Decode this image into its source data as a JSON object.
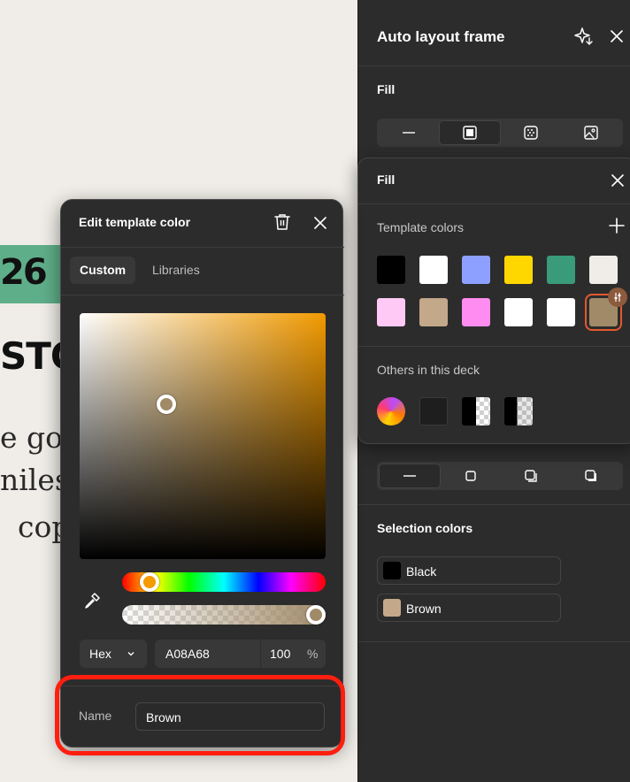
{
  "canvas": {
    "badge_text": "26",
    "heading_fragment": "STO",
    "body_lines": [
      "e  go",
      "nilest",
      "cop"
    ]
  },
  "panel": {
    "title": "Auto layout frame",
    "fill_label": "Fill",
    "selection_colors_label": "Selection colors",
    "selection_colors": [
      {
        "name": "Black",
        "color": "#000000"
      },
      {
        "name": "Brown",
        "color": "#c4a88a"
      }
    ]
  },
  "fill_popover": {
    "title": "Fill",
    "template_colors_label": "Template colors",
    "template_colors": [
      "#000000",
      "#ffffff",
      "#8ea0ff",
      "#ffd700",
      "#3a9b7a",
      "#f0ede8",
      "#ffc9f5",
      "#c4a88a",
      "#ff8cf0",
      "#ffffff",
      "#ffffff",
      "#a08a68"
    ],
    "others_label": "Others in this deck"
  },
  "edit_popover": {
    "title": "Edit template color",
    "tabs": [
      {
        "label": "Custom",
        "active": true
      },
      {
        "label": "Libraries",
        "active": false
      }
    ],
    "format": "Hex",
    "hex_value": "A08A68",
    "opacity": "100",
    "opacity_unit": "%",
    "name_label": "Name",
    "name_value": "Brown"
  },
  "accent_color": "#e4592c",
  "highlight_color": "#ff1e0f"
}
